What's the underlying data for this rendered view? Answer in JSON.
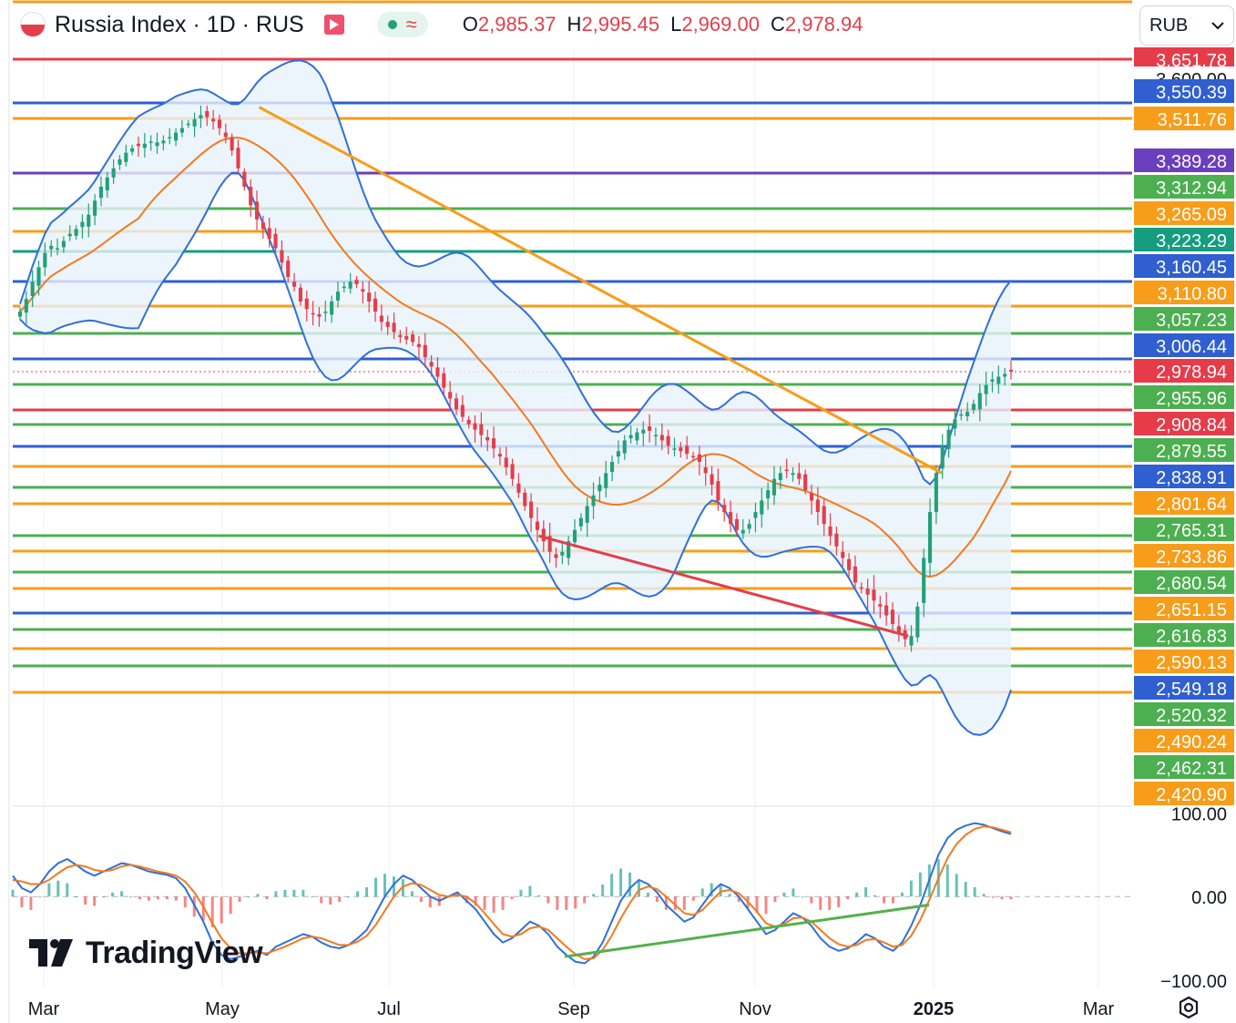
{
  "header": {
    "title": "Russia Index · 1D · RUS",
    "ohlc": [
      {
        "k": "O",
        "v": "2,985.37"
      },
      {
        "k": "H",
        "v": "2,995.45"
      },
      {
        "k": "L",
        "v": "2,969.00"
      },
      {
        "k": "C",
        "v": "2,978.94"
      }
    ]
  },
  "currency_select": {
    "value": "RUB"
  },
  "logo": {
    "text": "TradingView"
  },
  "colors": {
    "up": "#22a079",
    "down": "#e53d4b",
    "bb": "#2f6fdc",
    "bb_fill": "#e8f3fb",
    "ma": "#f4791f",
    "orange": "#f79d1a",
    "green": "#4caf50",
    "blue": "#2f5fd0",
    "red": "#e63c4a",
    "purple": "#6a3fbd",
    "teal": "#169c7f"
  },
  "chart_data": [
    {
      "type": "candlestick",
      "title": "Russia Index · 1D · RUS",
      "ylim": [
        2380,
        3690
      ],
      "x_ticks": [
        {
          "label": "Mar",
          "bold": false
        },
        {
          "label": "May",
          "bold": false
        },
        {
          "label": "Jul",
          "bold": false
        },
        {
          "label": "Sep",
          "bold": false
        },
        {
          "label": "Nov",
          "bold": false
        },
        {
          "label": "2025",
          "bold": true
        },
        {
          "label": "Mar",
          "bold": false
        }
      ],
      "last_price": 2978.94,
      "levels": [
        {
          "value": 3651.78,
          "label": "3,651.78",
          "color": "red"
        },
        {
          "value": 3600.0,
          "label": "3,600.00",
          "color": "none"
        },
        {
          "value": 3550.39,
          "label": "3,550.39",
          "color": "blue"
        },
        {
          "value": 3511.76,
          "label": "3,511.76",
          "color": "orange"
        },
        {
          "value": 3389.28,
          "label": "3,389.28",
          "color": "purple"
        },
        {
          "value": 3312.94,
          "label": "3,312.94",
          "color": "green"
        },
        {
          "value": 3265.09,
          "label": "3,265.09",
          "color": "orange"
        },
        {
          "value": 3223.29,
          "label": "3,223.29",
          "color": "teal"
        },
        {
          "value": 3160.45,
          "label": "3,160.45",
          "color": "blue"
        },
        {
          "value": 3110.8,
          "label": "3,110.80",
          "color": "orange"
        },
        {
          "value": 3057.23,
          "label": "3,057.23",
          "color": "green"
        },
        {
          "value": 3006.44,
          "label": "3,006.44",
          "color": "blue"
        },
        {
          "value": 2978.94,
          "label": "2,978.94",
          "color": "red",
          "last": true
        },
        {
          "value": 2955.96,
          "label": "2,955.96",
          "color": "green"
        },
        {
          "value": 2908.84,
          "label": "2,908.84",
          "color": "red"
        },
        {
          "value": 2879.55,
          "label": "2,879.55",
          "color": "green"
        },
        {
          "value": 2838.91,
          "label": "2,838.91",
          "color": "blue"
        },
        {
          "value": 2801.64,
          "label": "2,801.64",
          "color": "orange"
        },
        {
          "value": 2765.31,
          "label": "2,765.31",
          "color": "green"
        },
        {
          "value": 2733.86,
          "label": "2,733.86",
          "color": "orange"
        },
        {
          "value": 2680.54,
          "label": "2,680.54",
          "color": "green"
        },
        {
          "value": 2651.15,
          "label": "2,651.15",
          "color": "orange"
        },
        {
          "value": 2616.83,
          "label": "2,616.83",
          "color": "green"
        },
        {
          "value": 2590.13,
          "label": "2,590.13",
          "color": "orange"
        },
        {
          "value": 2549.18,
          "label": "2,549.18",
          "color": "blue"
        },
        {
          "value": 2520.32,
          "label": "2,520.32",
          "color": "green"
        },
        {
          "value": 2490.24,
          "label": "2,490.24",
          "color": "orange"
        },
        {
          "value": 2462.31,
          "label": "2,462.31",
          "color": "green"
        },
        {
          "value": 2420.9,
          "label": "2,420.90",
          "color": "orange"
        }
      ],
      "closes": [
        3100,
        3125,
        3160,
        3190,
        3220,
        3235,
        3230,
        3245,
        3260,
        3270,
        3285,
        3300,
        3330,
        3360,
        3380,
        3400,
        3420,
        3435,
        3445,
        3450,
        3455,
        3460,
        3458,
        3462,
        3470,
        3480,
        3490,
        3500,
        3510,
        3520,
        3515,
        3505,
        3490,
        3470,
        3440,
        3400,
        3360,
        3320,
        3290,
        3270,
        3250,
        3230,
        3200,
        3170,
        3150,
        3120,
        3105,
        3095,
        3090,
        3100,
        3120,
        3140,
        3150,
        3160,
        3155,
        3140,
        3120,
        3100,
        3080,
        3070,
        3060,
        3050,
        3045,
        3040,
        3030,
        3010,
        2990,
        2970,
        2950,
        2930,
        2910,
        2895,
        2880,
        2870,
        2860,
        2850,
        2835,
        2820,
        2800,
        2780,
        2755,
        2730,
        2710,
        2690,
        2670,
        2650,
        2640,
        2650,
        2670,
        2690,
        2710,
        2730,
        2750,
        2770,
        2790,
        2810,
        2830,
        2850,
        2860,
        2865,
        2870,
        2868,
        2860,
        2850,
        2840,
        2835,
        2830,
        2825,
        2820,
        2810,
        2790,
        2770,
        2740,
        2720,
        2700,
        2690,
        2690,
        2700,
        2720,
        2740,
        2760,
        2780,
        2790,
        2795,
        2790,
        2780,
        2760,
        2740,
        2720,
        2700,
        2680,
        2660,
        2640,
        2620,
        2600,
        2590,
        2580,
        2570,
        2560,
        2545,
        2530,
        2515,
        2505,
        2510,
        2560,
        2640,
        2720,
        2790,
        2840,
        2870,
        2890,
        2900,
        2905,
        2920,
        2940,
        2955,
        2965,
        2970,
        2975,
        2978.94
      ],
      "trendlines": [
        {
          "from": [
            0.22,
            3540
          ],
          "to": [
            0.83,
            2790
          ],
          "color": "orange"
        },
        {
          "from": [
            0.47,
            2680
          ],
          "to": [
            0.8,
            2510
          ],
          "color": "red"
        }
      ]
    },
    {
      "type": "line",
      "title": "",
      "ylim": [
        -110,
        105
      ],
      "y_ticks": [
        {
          "value": 100,
          "label": "100.00"
        },
        {
          "value": 0,
          "label": "0.00"
        },
        {
          "value": -100,
          "label": "−100.00"
        }
      ],
      "series": [
        {
          "role": "fast",
          "values": [
            25,
            10,
            5,
            15,
            30,
            40,
            45,
            38,
            30,
            25,
            30,
            35,
            40,
            38,
            34,
            30,
            28,
            26,
            22,
            10,
            -10,
            -30,
            -55,
            -70,
            -75,
            -72,
            -68,
            -65,
            -70,
            -60,
            -55,
            -50,
            -45,
            -48,
            -55,
            -60,
            -62,
            -58,
            -50,
            -40,
            -20,
            0,
            15,
            25,
            20,
            10,
            0,
            -5,
            0,
            5,
            -5,
            -15,
            -30,
            -45,
            -55,
            -50,
            -40,
            -30,
            -35,
            -45,
            -60,
            -70,
            -78,
            -80,
            -72,
            -55,
            -30,
            -5,
            10,
            20,
            15,
            5,
            -10,
            -20,
            -30,
            -25,
            -10,
            5,
            15,
            10,
            0,
            -15,
            -30,
            -45,
            -40,
            -30,
            -20,
            -25,
            -35,
            -50,
            -60,
            -65,
            -62,
            -55,
            -45,
            -50,
            -60,
            -65,
            -55,
            -35,
            -10,
            20,
            50,
            70,
            80,
            85,
            88,
            86,
            82,
            78,
            75
          ]
        },
        {
          "role": "slow",
          "values": [
            20,
            18,
            15,
            15,
            20,
            28,
            35,
            38,
            36,
            32,
            30,
            32,
            36,
            38,
            36,
            33,
            30,
            28,
            25,
            18,
            5,
            -12,
            -32,
            -50,
            -62,
            -68,
            -68,
            -67,
            -68,
            -64,
            -60,
            -55,
            -50,
            -48,
            -50,
            -54,
            -58,
            -58,
            -54,
            -47,
            -34,
            -17,
            0,
            12,
            16,
            14,
            8,
            2,
            0,
            2,
            0,
            -8,
            -20,
            -33,
            -45,
            -48,
            -45,
            -38,
            -36,
            -40,
            -50,
            -60,
            -69,
            -75,
            -74,
            -64,
            -47,
            -26,
            -8,
            8,
            12,
            9,
            0,
            -10,
            -20,
            -22,
            -16,
            -5,
            6,
            8,
            4,
            -6,
            -18,
            -32,
            -36,
            -33,
            -26,
            -25,
            -30,
            -40,
            -50,
            -57,
            -60,
            -58,
            -52,
            -51,
            -55,
            -60,
            -58,
            -47,
            -28,
            -4,
            22,
            46,
            63,
            74,
            81,
            84,
            83,
            80,
            77
          ]
        }
      ]
    }
  ]
}
